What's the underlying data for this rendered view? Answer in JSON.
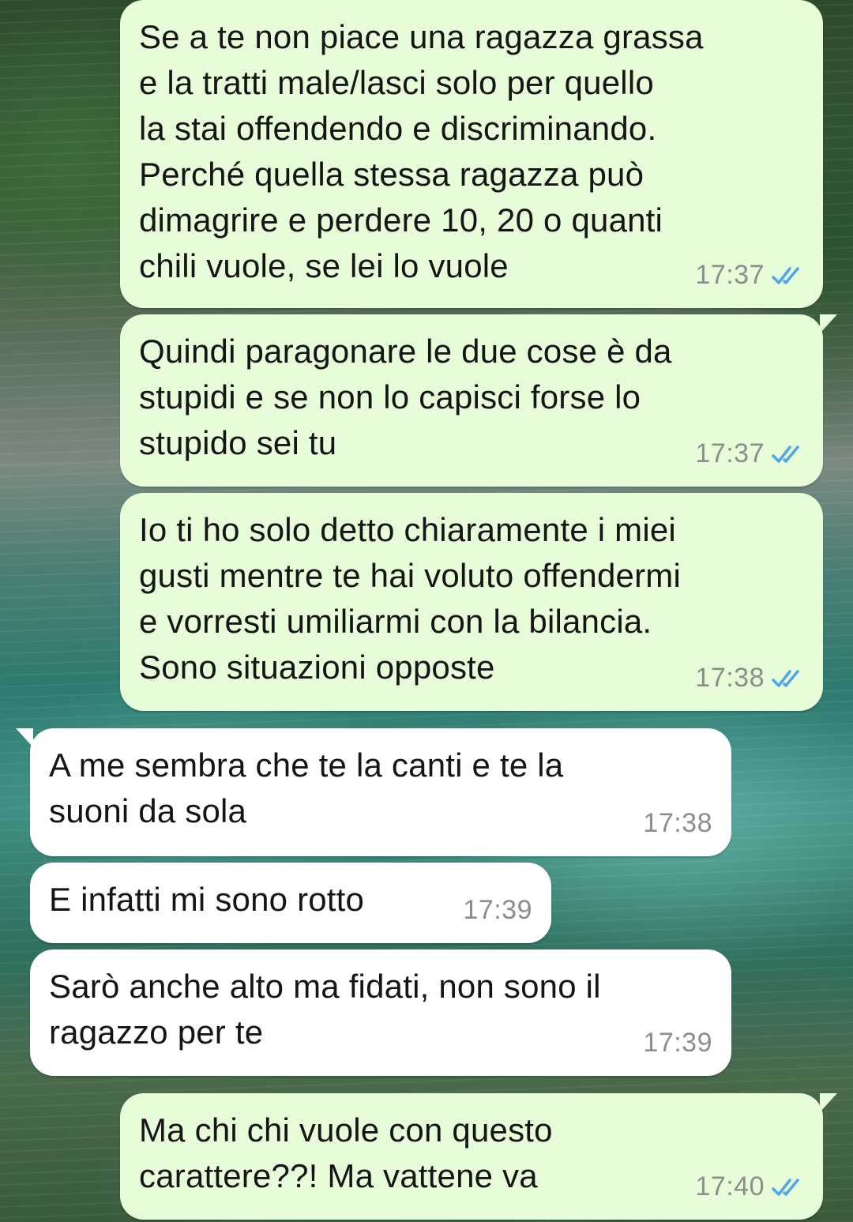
{
  "chat": {
    "messages": [
      {
        "direction": "outgoing",
        "text": "Se a te non piace una ragazza grassa\ne la tratti male/lasci solo per quello\nla stai offendendo e discriminando.\nPerché quella stessa ragazza può\ndimagrire e perdere 10, 20 o quanti\nchili vuole, se lei lo vuole",
        "time": "17:37",
        "status": "read-double-check-icon"
      },
      {
        "direction": "outgoing",
        "text": "Quindi paragonare le due cose è da\nstupidi e se non lo capisci forse lo\nstupido sei tu",
        "time": "17:37",
        "status": "read-double-check-icon"
      },
      {
        "direction": "outgoing",
        "text": "Io ti ho solo detto chiaramente i miei\ngusti mentre te hai voluto offendermi\ne vorresti umiliarmi con la bilancia.\nSono situazioni opposte",
        "time": "17:38",
        "status": "read-double-check-icon"
      },
      {
        "direction": "incoming",
        "text": "A me sembra che te la canti e te la\nsuoni da sola",
        "time": "17:38"
      },
      {
        "direction": "incoming",
        "text": "E infatti mi sono rotto",
        "time": "17:39"
      },
      {
        "direction": "incoming",
        "text": "Sarò anche alto ma fidati, non sono il\nragazzo per te",
        "time": "17:39"
      },
      {
        "direction": "outgoing",
        "text": "Ma chi chi vuole con questo\ncarattere??! Ma vattene va",
        "time": "17:40",
        "status": "read-double-check-icon"
      }
    ]
  },
  "colors": {
    "outgoing_bubble": "#e7fcd9",
    "incoming_bubble": "#ffffff",
    "read_check": "#4fa6e8",
    "timestamp": "#8b8f8c"
  }
}
